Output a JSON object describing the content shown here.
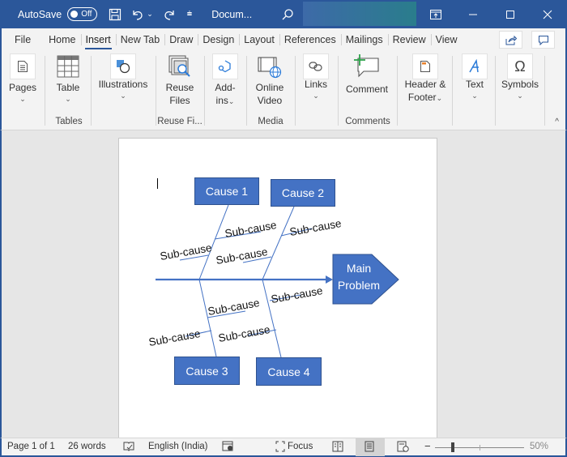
{
  "titlebar": {
    "autosave_label": "AutoSave",
    "autosave_state": "Off",
    "doc_title": "Docum...",
    "icons": [
      "save-icon",
      "undo-icon",
      "undo-dropdown-icon",
      "redo-icon",
      "customize-qat-icon",
      "search-icon"
    ],
    "window_controls": [
      "ribbon-display-options-icon",
      "minimize-icon",
      "maximize-icon",
      "close-icon"
    ]
  },
  "tabs": [
    {
      "label": "File"
    },
    {
      "label": "Home"
    },
    {
      "label": "Insert",
      "active": true
    },
    {
      "label": "New Tab"
    },
    {
      "label": "Draw"
    },
    {
      "label": "Design"
    },
    {
      "label": "Layout"
    },
    {
      "label": "References"
    },
    {
      "label": "Mailings"
    },
    {
      "label": "Review"
    },
    {
      "label": "View"
    }
  ],
  "tab_buttons": [
    "share-icon",
    "comments-icon"
  ],
  "ribbon": {
    "buttons": {
      "pages": "Pages",
      "table": "Table",
      "illustrations": "Illustrations",
      "reuse_files_1": "Reuse",
      "reuse_files_2": "Files",
      "addins_1": "Add-",
      "addins_2": "ins",
      "online_video_1": "Online",
      "online_video_2": "Video",
      "links": "Links",
      "comment": "Comment",
      "header_footer_1": "Header &",
      "header_footer_2": "Footer",
      "text": "Text",
      "symbols": "Symbols"
    },
    "groups": {
      "tables": "Tables",
      "reuse_files": "Reuse Fi...",
      "media": "Media",
      "comments": "Comments"
    },
    "chevron": "⌄",
    "collapse": "^"
  },
  "diagram": {
    "causes": [
      "Cause 1",
      "Cause 2",
      "Cause 3",
      "Cause 4"
    ],
    "sub_cause": "Sub-cause",
    "main_problem_1": "Main",
    "main_problem_2": "Problem",
    "colors": {
      "box": "#4472c4",
      "box_border": "#2f528f",
      "line": "#4472c4"
    }
  },
  "statusbar": {
    "page": "Page 1 of 1",
    "words": "26 words",
    "language": "English (India)",
    "focus": "Focus",
    "zoom": "50%"
  },
  "colors": {
    "brand": "#2b579a",
    "ribbon_bg": "#f3f3f3",
    "canvas_bg": "#e6e6e6"
  }
}
